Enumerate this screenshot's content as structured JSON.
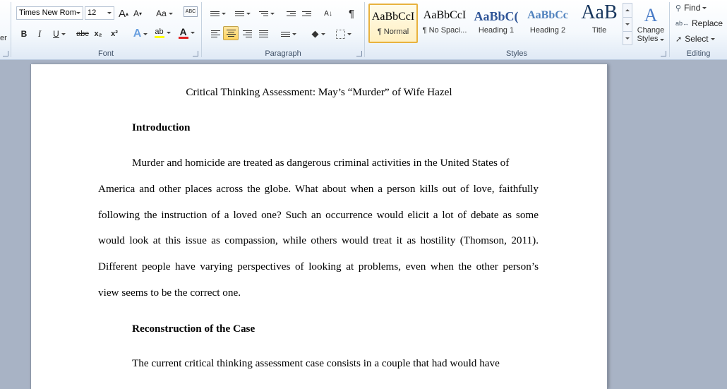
{
  "ribbon": {
    "clipboard_tail": "er",
    "font": {
      "label": "Font",
      "font_name": "Times New Rom",
      "font_size": "12",
      "grow_glyph": "A",
      "shrink_glyph": "A",
      "change_case": "Aa",
      "clear_format": "ABC",
      "bold": "B",
      "italic": "I",
      "underline": "U",
      "strikethrough": "abc",
      "subscript": "x₂",
      "superscript": "x²",
      "text_effects": "A",
      "highlight": "ab",
      "font_color": "A"
    },
    "paragraph": {
      "label": "Paragraph",
      "pilcrow": "¶",
      "sort": "A↓"
    },
    "styles": {
      "label": "Styles",
      "items": [
        {
          "sample": "AaBbCcI",
          "name": "¶ Normal"
        },
        {
          "sample": "AaBbCcI",
          "name": "¶ No Spaci..."
        },
        {
          "sample": "AaBbC(",
          "name": "Heading 1"
        },
        {
          "sample": "AaBbCc",
          "name": "Heading 2"
        },
        {
          "sample": "AaB",
          "name": "Title"
        }
      ],
      "change_styles_line1": "Change",
      "change_styles_line2": "Styles"
    },
    "editing": {
      "label": "Editing",
      "find": "Find",
      "replace": "Replace",
      "select": "Select"
    }
  },
  "colors": {
    "accent_highlight": "#ffd35e",
    "font_color_bar": "#e02020",
    "highlight_bar": "#ffff00",
    "heading_blue": "#2f5597"
  },
  "document": {
    "title": "Critical Thinking Assessment: May’s “Murder” of Wife Hazel",
    "heading1": "Introduction",
    "para1": [
      "Murder and homicide are treated as dangerous criminal activities in the United States of",
      "America and other places across the globe. What about when a person kills out of love, faithfully",
      "following the instruction of a loved one? Such an occurrence would elicit a lot of debate as some",
      "would look at this issue as compassion, while others would treat it as hostility (Thomson, 2011).",
      "Different people have varying perspectives of looking at problems, even when the other person’s",
      "view seems to be the correct one."
    ],
    "heading2": "Reconstruction of the Case",
    "para2": [
      "The current critical thinking assessment case consists in a couple that had would have"
    ]
  }
}
